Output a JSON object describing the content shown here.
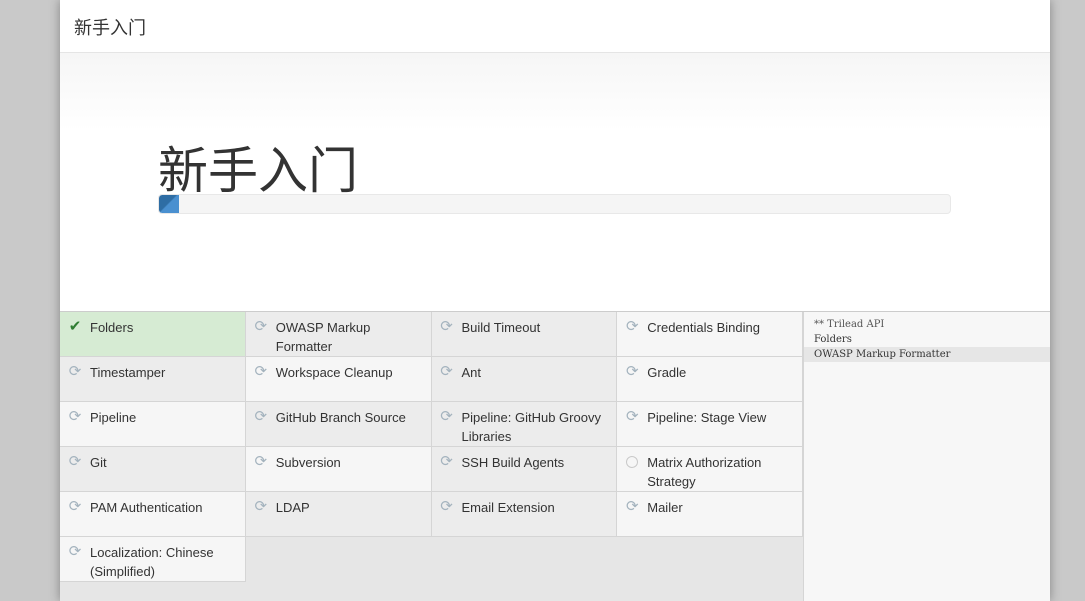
{
  "dialog": {
    "header_title": "新手入门",
    "hero_title": "新手入门",
    "progress_fraction": 0.025,
    "progress_color": "#2e6da4"
  },
  "plugins": [
    {
      "label": "Folders",
      "state": "success",
      "icon": "checkmark-icon"
    },
    {
      "label": "OWASP Markup Formatter",
      "state": "installing",
      "icon": "refresh-icon"
    },
    {
      "label": "Build Timeout",
      "state": "installing",
      "icon": "refresh-icon"
    },
    {
      "label": "Credentials Binding",
      "state": "installing",
      "icon": "refresh-icon"
    },
    {
      "label": "Timestamper",
      "state": "installing",
      "icon": "refresh-icon"
    },
    {
      "label": "Workspace Cleanup",
      "state": "installing",
      "icon": "refresh-icon"
    },
    {
      "label": "Ant",
      "state": "installing",
      "icon": "refresh-icon"
    },
    {
      "label": "Gradle",
      "state": "installing",
      "icon": "refresh-icon"
    },
    {
      "label": "Pipeline",
      "state": "installing",
      "icon": "refresh-icon"
    },
    {
      "label": "GitHub Branch Source",
      "state": "installing",
      "icon": "refresh-icon"
    },
    {
      "label": "Pipeline: GitHub Groovy Libraries",
      "state": "installing",
      "icon": "refresh-icon"
    },
    {
      "label": "Pipeline: Stage View",
      "state": "installing",
      "icon": "refresh-icon"
    },
    {
      "label": "Git",
      "state": "installing",
      "icon": "refresh-icon"
    },
    {
      "label": "Subversion",
      "state": "installing",
      "icon": "refresh-icon"
    },
    {
      "label": "SSH Build Agents",
      "state": "installing",
      "icon": "refresh-icon"
    },
    {
      "label": "Matrix Authorization Strategy",
      "state": "pending",
      "icon": "circle-icon"
    },
    {
      "label": "PAM Authentication",
      "state": "installing",
      "icon": "refresh-icon"
    },
    {
      "label": "LDAP",
      "state": "installing",
      "icon": "refresh-icon"
    },
    {
      "label": "Email Extension",
      "state": "installing",
      "icon": "refresh-icon"
    },
    {
      "label": "Mailer",
      "state": "installing",
      "icon": "refresh-icon"
    },
    {
      "label": "Localization: Chinese (Simplified)",
      "state": "installing",
      "icon": "refresh-icon"
    }
  ],
  "log": [
    {
      "text": "** Trilead API",
      "style": "dim"
    },
    {
      "text": "Folders",
      "style": "normal"
    },
    {
      "text": "OWASP Markup Formatter",
      "style": "current"
    }
  ],
  "colors": {
    "success_bg": "#d6ebd3",
    "success_icon": "#2f7d32",
    "pending_icon": "#a4b3be"
  }
}
